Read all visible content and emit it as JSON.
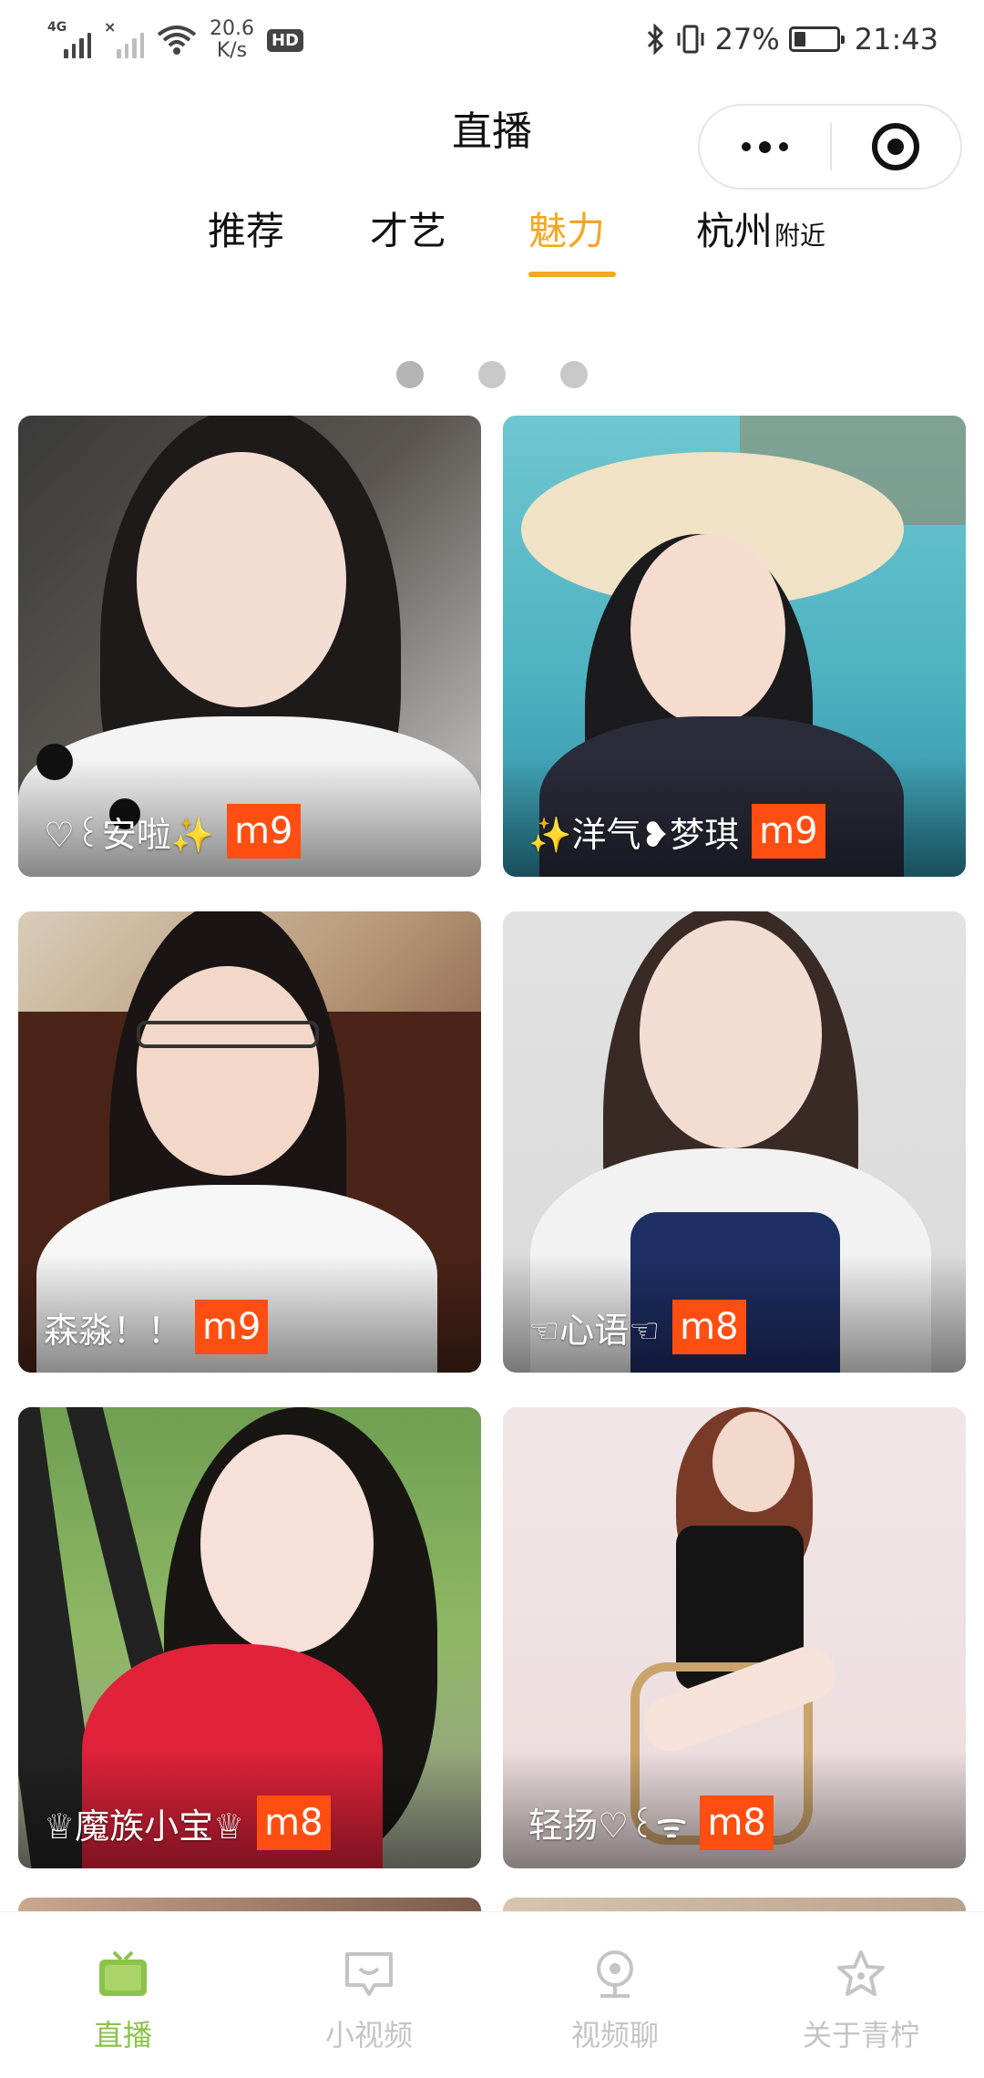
{
  "status_bar": {
    "network_tag_1": "4G",
    "network_speed_value": "20.6",
    "network_speed_unit": "K/s",
    "hd_badge": "HD",
    "battery_percent": "27%",
    "battery_level": 0.27,
    "time": "21:43"
  },
  "header": {
    "title": "直播",
    "capsule_more_icon": "more-dots-icon",
    "capsule_close_icon": "target-circle-icon"
  },
  "tabs": [
    {
      "label": "推荐",
      "active": false
    },
    {
      "label": "才艺",
      "active": false
    },
    {
      "label": "魅力",
      "active": true
    },
    {
      "label": "杭州",
      "sub": "附近",
      "active": false
    }
  ],
  "pager": {
    "count": 3,
    "current": 0
  },
  "cards": [
    {
      "name": "♡꒰安啦✨",
      "level": "m9"
    },
    {
      "name": "✨洋气❥梦琪",
      "level": "m9"
    },
    {
      "name": "森淼！！",
      "level": "m9"
    },
    {
      "name": "☜心语☜",
      "level": "m8"
    },
    {
      "name": "♕魔族小宝♕",
      "level": "m8"
    },
    {
      "name": "轻扬♡꒰ᯤ",
      "level": "m8"
    }
  ],
  "bottom_nav": [
    {
      "label": "直播",
      "icon": "tv-icon",
      "active": true
    },
    {
      "label": "小视频",
      "icon": "chat-bubble-icon",
      "active": false
    },
    {
      "label": "视频聊",
      "icon": "webcam-icon",
      "active": false
    },
    {
      "label": "关于青柠",
      "icon": "star-icon",
      "active": false
    }
  ],
  "colors": {
    "accent_tab": "#f5a623",
    "level_badge": "#ff4e11",
    "nav_active": "#8bc34a",
    "nav_inactive": "#c4c4c4"
  }
}
